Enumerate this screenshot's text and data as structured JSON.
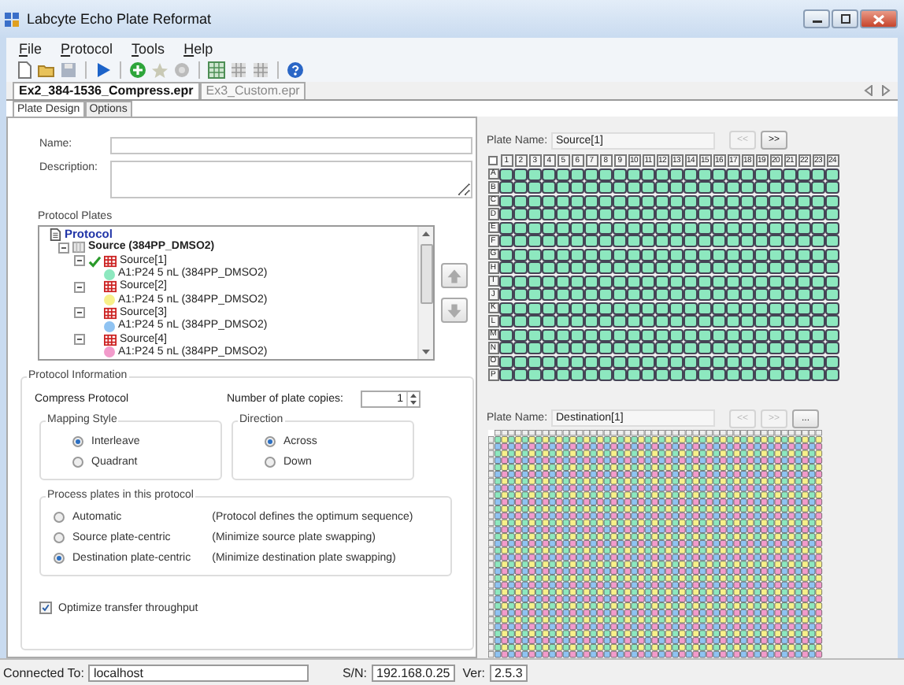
{
  "window": {
    "title": "Labcyte Echo Plate Reformat"
  },
  "menu": [
    "File",
    "Protocol",
    "Tools",
    "Help"
  ],
  "document_tabs": [
    {
      "label": "Ex2_384-1536_Compress.epr",
      "selected": true
    },
    {
      "label": "Ex3_Custom.epr",
      "selected": false
    }
  ],
  "sub_tabs": [
    {
      "label": "Plate Design",
      "selected": true
    },
    {
      "label": "Options",
      "selected": false
    }
  ],
  "form": {
    "name_label": "Name:",
    "description_label": "Description:"
  },
  "protocol_plates": {
    "label": "Protocol Plates",
    "tree": {
      "label": "Protocol",
      "children": [
        {
          "label": "Source  (384PP_DMSO2)",
          "expanded": true,
          "children": [
            {
              "label": "Source[1]",
              "checked": true,
              "expanded": true,
              "children": [
                {
                  "label": "A1:P24 5 nL (384PP_DMSO2)",
                  "color": "#8de8bf"
                }
              ]
            },
            {
              "label": "Source[2]",
              "checked": false,
              "expanded": true,
              "children": [
                {
                  "label": "A1:P24 5 nL (384PP_DMSO2)",
                  "color": "#f7f08a"
                }
              ]
            },
            {
              "label": "Source[3]",
              "checked": false,
              "expanded": true,
              "children": [
                {
                  "label": "A1:P24 5 nL (384PP_DMSO2)",
                  "color": "#8fc3f2"
                }
              ]
            },
            {
              "label": "Source[4]",
              "checked": false,
              "expanded": true,
              "children": [
                {
                  "label": "A1:P24 5 nL (384PP_DMSO2)",
                  "color": "#f29bcb"
                }
              ]
            }
          ]
        }
      ]
    }
  },
  "protocol_information": {
    "title": "Protocol Information",
    "mode": "Compress Protocol",
    "copies_label": "Number of plate copies:",
    "copies": "1",
    "mapping_style": {
      "title": "Mapping Style",
      "options": [
        {
          "label": "Interleave",
          "selected": true
        },
        {
          "label": "Quadrant",
          "selected": false
        }
      ]
    },
    "direction": {
      "title": "Direction",
      "options": [
        {
          "label": "Across",
          "selected": true
        },
        {
          "label": "Down",
          "selected": false
        }
      ]
    },
    "process": {
      "title": "Process plates in this protocol",
      "options": [
        {
          "label": "Automatic",
          "note": "(Protocol defines the optimum sequence)",
          "selected": false
        },
        {
          "label": "Source plate-centric",
          "note": "(Minimize source plate swapping)",
          "selected": false
        },
        {
          "label": "Destination plate-centric",
          "note": "(Minimize destination plate swapping)",
          "selected": true
        }
      ]
    },
    "optimize": {
      "label": "Optimize transfer throughput",
      "checked": true
    }
  },
  "source_plate": {
    "plate_name_label": "Plate Name:",
    "plate_name": "Source[1]",
    "buttons": [
      {
        "label": "<<",
        "disabled": true
      },
      {
        "label": ">>",
        "disabled": false
      }
    ],
    "columns": [
      "1",
      "2",
      "3",
      "4",
      "5",
      "6",
      "7",
      "8",
      "9",
      "10",
      "11",
      "12",
      "13",
      "14",
      "15",
      "16",
      "17",
      "18",
      "19",
      "20",
      "21",
      "22",
      "23",
      "24"
    ],
    "rows": [
      "A",
      "B",
      "C",
      "D",
      "E",
      "F",
      "G",
      "H",
      "I",
      "J",
      "K",
      "L",
      "M",
      "N",
      "O",
      "P"
    ]
  },
  "destination_plate": {
    "plate_name_label": "Plate Name:",
    "plate_name": "Destination[1]",
    "buttons": [
      {
        "label": "<<",
        "disabled": true
      },
      {
        "label": ">>",
        "disabled": true
      },
      {
        "label": "...",
        "disabled": false
      }
    ]
  },
  "status_bar": {
    "connected_label": "Connected To:",
    "host": "localhost",
    "sn_label": "S/N:",
    "sn": "192.168.0.25",
    "ver_label": "Ver:",
    "version": "2.5.3"
  }
}
